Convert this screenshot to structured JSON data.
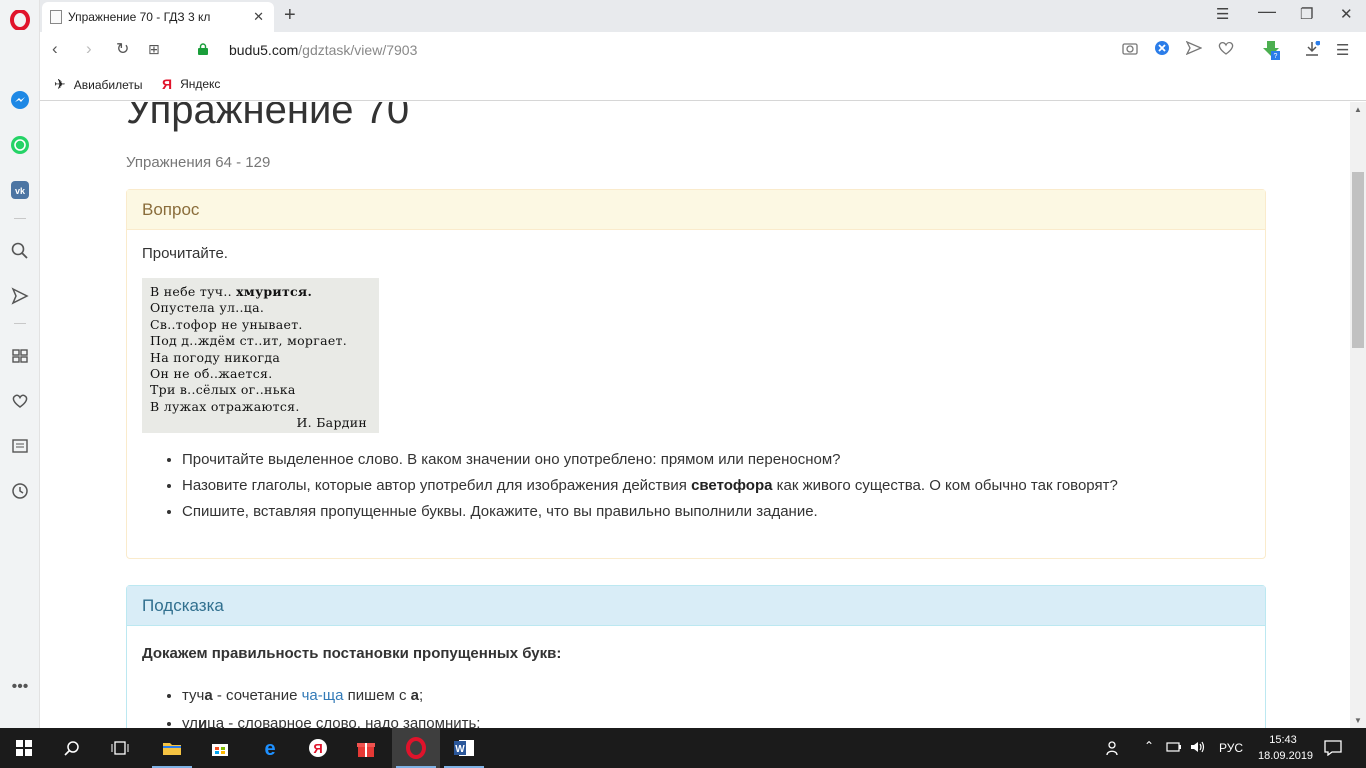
{
  "browser": {
    "tab_title": "Упражнение 70 - ГДЗ 3 кл",
    "url_host": "budu5.com",
    "url_path": "/gdztask/view/7903",
    "bookmarks": [
      "Авиабилеты",
      "Яндекс"
    ]
  },
  "page": {
    "title": "Упражнение 70",
    "subtitle": "Упражнения 64 - 129",
    "question": {
      "header": "Вопрос",
      "intro": "Прочитайте.",
      "poem_lines": [
        "В небе туч..",
        "хмурится.",
        "Опустела ул..ца.",
        "Св..тофор не унывает.",
        "Под д..ждём ст..ит, моргает.",
        "На погоду никогда",
        "Он не об..жается.",
        "Три в..сёлых ог..нька",
        "В лужах отражаются.",
        "И. Бардин"
      ],
      "items": [
        "Прочитайте выделенное слово. В каком значении оно употреблено: прямом или переносном?",
        "Назовите глаголы, которые автор употребил для изображения действия",
        "светофора",
        "как живого существа. О ком обычно так говорят?",
        "Спишите, вставляя пропущенные буквы. Докажите, что вы правильно выполнили задание."
      ]
    },
    "hint": {
      "header": "Подсказка",
      "title": "Докажем правильность постановки пропущенных букв:",
      "item1_word_a": "туч",
      "item1_word_b": "а",
      "item1_rest": " - сочетание ",
      "item1_link": "ча-ща",
      "item1_tail": " пишем с ",
      "item1_letter": "а",
      "item1_end": ";",
      "item2_word_a": "ул",
      "item2_word_b": "и",
      "item2_word_c": "ца",
      "item2_rest": " - словарное слово, надо запомнить;"
    }
  },
  "taskbar": {
    "lang": "РУС",
    "time": "15:43",
    "date": "18.09.2019"
  },
  "colors": {
    "question_header_bg": "#fcf8e3",
    "hint_header_bg": "#d9edf7",
    "opera_red": "#e0132b",
    "link": "#337ab7"
  }
}
